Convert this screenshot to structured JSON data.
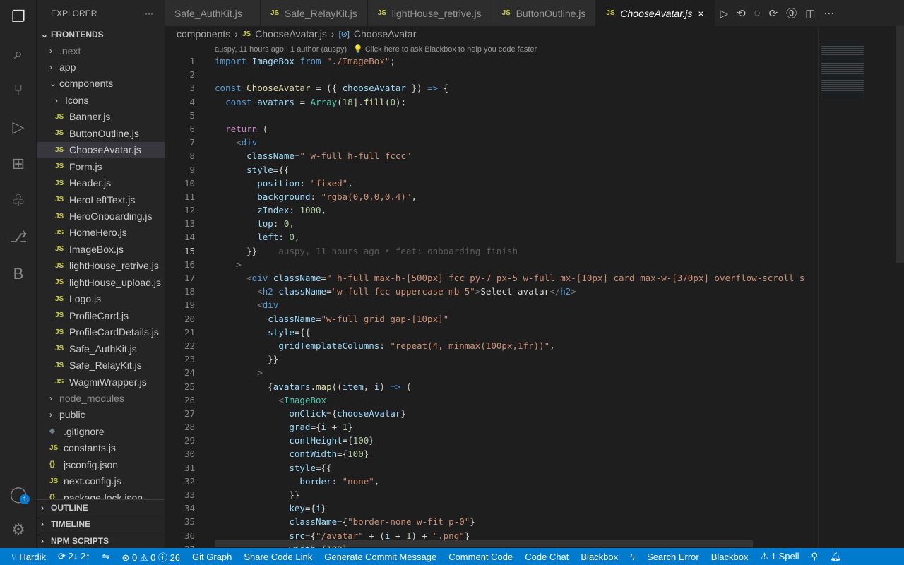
{
  "activity": [
    {
      "icon": "files-icon",
      "active": true
    },
    {
      "icon": "search-icon"
    },
    {
      "icon": "source-control-icon"
    },
    {
      "icon": "run-debug-icon"
    },
    {
      "icon": "extensions-icon"
    },
    {
      "icon": "tree-icon"
    },
    {
      "icon": "git-graph-icon"
    },
    {
      "icon": "blackbox-icon",
      "label": "B"
    }
  ],
  "account_badge": "1",
  "sidebar": {
    "title": "EXPLORER",
    "more": "···",
    "root": "FRONTENDS",
    "items": [
      {
        "label": ".next",
        "depth": 1,
        "type": "folder",
        "open": false,
        "dim": true
      },
      {
        "label": "app",
        "depth": 1,
        "type": "folder",
        "open": false
      },
      {
        "label": "components",
        "depth": 1,
        "type": "folder",
        "open": true
      },
      {
        "label": "Icons",
        "depth": 2,
        "type": "folder",
        "open": false
      },
      {
        "label": "Banner.js",
        "depth": 2,
        "type": "js"
      },
      {
        "label": "ButtonOutline.js",
        "depth": 2,
        "type": "js"
      },
      {
        "label": "ChooseAvatar.js",
        "depth": 2,
        "type": "js",
        "selected": true
      },
      {
        "label": "Form.js",
        "depth": 2,
        "type": "js"
      },
      {
        "label": "Header.js",
        "depth": 2,
        "type": "js"
      },
      {
        "label": "HeroLeftText.js",
        "depth": 2,
        "type": "js"
      },
      {
        "label": "HeroOnboarding.js",
        "depth": 2,
        "type": "js"
      },
      {
        "label": "HomeHero.js",
        "depth": 2,
        "type": "js"
      },
      {
        "label": "ImageBox.js",
        "depth": 2,
        "type": "js"
      },
      {
        "label": "lightHouse_retrive.js",
        "depth": 2,
        "type": "js"
      },
      {
        "label": "lightHouse_upload.js",
        "depth": 2,
        "type": "js"
      },
      {
        "label": "Logo.js",
        "depth": 2,
        "type": "js"
      },
      {
        "label": "ProfileCard.js",
        "depth": 2,
        "type": "js"
      },
      {
        "label": "ProfileCardDetails.js",
        "depth": 2,
        "type": "js"
      },
      {
        "label": "Safe_AuthKit.js",
        "depth": 2,
        "type": "js"
      },
      {
        "label": "Safe_RelayKit.js",
        "depth": 2,
        "type": "js"
      },
      {
        "label": "WagmiWrapper.js",
        "depth": 2,
        "type": "js"
      },
      {
        "label": "node_modules",
        "depth": 1,
        "type": "folder",
        "open": false,
        "dim": true
      },
      {
        "label": "public",
        "depth": 1,
        "type": "folder",
        "open": false
      },
      {
        "label": ".gitignore",
        "depth": 1,
        "type": "git"
      },
      {
        "label": "constants.js",
        "depth": 1,
        "type": "js"
      },
      {
        "label": "jsconfig.json",
        "depth": 1,
        "type": "json"
      },
      {
        "label": "next.config.js",
        "depth": 1,
        "type": "js"
      },
      {
        "label": "package-lock.json",
        "depth": 1,
        "type": "json"
      }
    ],
    "panels": [
      "OUTLINE",
      "TIMELINE",
      "NPM SCRIPTS"
    ]
  },
  "tabs": [
    {
      "label": "Safe_AuthKit.js"
    },
    {
      "label": "Safe_RelayKit.js"
    },
    {
      "label": "lightHouse_retrive.js"
    },
    {
      "label": "ButtonOutline.js"
    },
    {
      "label": "ChooseAvatar.js",
      "active": true
    }
  ],
  "tab_close": "×",
  "breadcrumb": [
    "components",
    "ChooseAvatar.js",
    "ChooseAvatar"
  ],
  "codelens": "auspy, 11 hours ago | 1 author (auspy) | 💡 Click here to ask Blackbox to help you code faster",
  "current_line": 15,
  "code": [
    [
      [
        "k",
        "import"
      ],
      [
        "w",
        " "
      ],
      [
        "v",
        "ImageBox"
      ],
      [
        "w",
        " "
      ],
      [
        "k",
        "from"
      ],
      [
        "w",
        " "
      ],
      [
        "s",
        "\"./ImageBox\""
      ],
      [
        "w",
        ";"
      ]
    ],
    [],
    [
      [
        "k",
        "const"
      ],
      [
        "w",
        " "
      ],
      [
        "f",
        "ChooseAvatar"
      ],
      [
        "w",
        " = ({ "
      ],
      [
        "v",
        "chooseAvatar"
      ],
      [
        "w",
        " }) "
      ],
      [
        "k",
        "=>"
      ],
      [
        "w",
        " {"
      ]
    ],
    [
      [
        "w",
        "  "
      ],
      [
        "k",
        "const"
      ],
      [
        "w",
        " "
      ],
      [
        "v",
        "avatars"
      ],
      [
        "w",
        " = "
      ],
      [
        "t",
        "Array"
      ],
      [
        "w",
        "("
      ],
      [
        "n",
        "18"
      ],
      [
        "w",
        "]."
      ],
      [
        "f",
        "fill"
      ],
      [
        "w",
        "("
      ],
      [
        "n",
        "0"
      ],
      [
        "w",
        ");"
      ]
    ],
    [],
    [
      [
        "w",
        "  "
      ],
      [
        "c",
        "return"
      ],
      [
        "w",
        " ("
      ]
    ],
    [
      [
        "w",
        "    "
      ],
      [
        "g",
        "<"
      ],
      [
        "k",
        "div"
      ]
    ],
    [
      [
        "w",
        "      "
      ],
      [
        "v",
        "className"
      ],
      [
        "w",
        "="
      ],
      [
        "s",
        "\" w-full h-full fccc\""
      ]
    ],
    [
      [
        "w",
        "      "
      ],
      [
        "v",
        "style"
      ],
      [
        "w",
        "={{"
      ]
    ],
    [
      [
        "w",
        "        "
      ],
      [
        "v",
        "position"
      ],
      [
        "w",
        ": "
      ],
      [
        "s",
        "\"fixed\""
      ],
      [
        "w",
        ","
      ]
    ],
    [
      [
        "w",
        "        "
      ],
      [
        "v",
        "background"
      ],
      [
        "w",
        ": "
      ],
      [
        "s",
        "\"rgba(0,0,0,0.4)\""
      ],
      [
        "w",
        ","
      ]
    ],
    [
      [
        "w",
        "        "
      ],
      [
        "v",
        "zIndex"
      ],
      [
        "w",
        ": "
      ],
      [
        "n",
        "1000"
      ],
      [
        "w",
        ","
      ]
    ],
    [
      [
        "w",
        "        "
      ],
      [
        "v",
        "top"
      ],
      [
        "w",
        ": "
      ],
      [
        "n",
        "0"
      ],
      [
        "w",
        ","
      ]
    ],
    [
      [
        "w",
        "        "
      ],
      [
        "v",
        "left"
      ],
      [
        "w",
        ": "
      ],
      [
        "n",
        "0"
      ],
      [
        "w",
        ","
      ]
    ],
    [
      [
        "w",
        "      }}"
      ],
      [
        "bl",
        "    auspy, 11 hours ago • feat: onboarding finish"
      ]
    ],
    [
      [
        "w",
        "    "
      ],
      [
        "g",
        ">"
      ]
    ],
    [
      [
        "w",
        "      "
      ],
      [
        "g",
        "<"
      ],
      [
        "k",
        "div"
      ],
      [
        "w",
        " "
      ],
      [
        "v",
        "className"
      ],
      [
        "w",
        "="
      ],
      [
        "s",
        "\" h-full max-h-[500px] fcc py-7 px-5 w-full mx-[10px] card max-w-[370px] overflow-scroll s"
      ]
    ],
    [
      [
        "w",
        "        "
      ],
      [
        "g",
        "<"
      ],
      [
        "k",
        "h2"
      ],
      [
        "w",
        " "
      ],
      [
        "v",
        "className"
      ],
      [
        "w",
        "="
      ],
      [
        "s",
        "\"w-full fcc uppercase mb-5\""
      ],
      [
        "g",
        ">"
      ],
      [
        "w",
        "Select avatar"
      ],
      [
        "g",
        "</"
      ],
      [
        "k",
        "h2"
      ],
      [
        "g",
        ">"
      ]
    ],
    [
      [
        "w",
        "        "
      ],
      [
        "g",
        "<"
      ],
      [
        "k",
        "div"
      ]
    ],
    [
      [
        "w",
        "          "
      ],
      [
        "v",
        "className"
      ],
      [
        "w",
        "="
      ],
      [
        "s",
        "\"w-full grid gap-[10px]\""
      ]
    ],
    [
      [
        "w",
        "          "
      ],
      [
        "v",
        "style"
      ],
      [
        "w",
        "={{"
      ]
    ],
    [
      [
        "w",
        "            "
      ],
      [
        "v",
        "gridTemplateColumns"
      ],
      [
        "w",
        ": "
      ],
      [
        "s",
        "\"repeat(4, minmax(100px,1fr))\""
      ],
      [
        "w",
        ","
      ]
    ],
    [
      [
        "w",
        "          }}"
      ]
    ],
    [
      [
        "w",
        "        "
      ],
      [
        "g",
        ">"
      ]
    ],
    [
      [
        "w",
        "          {"
      ],
      [
        "v",
        "avatars"
      ],
      [
        "w",
        "."
      ],
      [
        "f",
        "map"
      ],
      [
        "w",
        "(("
      ],
      [
        "v",
        "item"
      ],
      [
        "w",
        ", "
      ],
      [
        "v",
        "i"
      ],
      [
        "w",
        ") "
      ],
      [
        "k",
        "=>"
      ],
      [
        "w",
        " ("
      ]
    ],
    [
      [
        "w",
        "            "
      ],
      [
        "g",
        "<"
      ],
      [
        "t",
        "ImageBox"
      ]
    ],
    [
      [
        "w",
        "              "
      ],
      [
        "v",
        "onClick"
      ],
      [
        "w",
        "={"
      ],
      [
        "v",
        "chooseAvatar"
      ],
      [
        "w",
        "}"
      ]
    ],
    [
      [
        "w",
        "              "
      ],
      [
        "v",
        "grad"
      ],
      [
        "w",
        "={"
      ],
      [
        "v",
        "i"
      ],
      [
        "w",
        " + "
      ],
      [
        "n",
        "1"
      ],
      [
        "w",
        "}"
      ]
    ],
    [
      [
        "w",
        "              "
      ],
      [
        "v",
        "contHeight"
      ],
      [
        "w",
        "={"
      ],
      [
        "n",
        "100"
      ],
      [
        "w",
        "}"
      ]
    ],
    [
      [
        "w",
        "              "
      ],
      [
        "v",
        "contWidth"
      ],
      [
        "w",
        "={"
      ],
      [
        "n",
        "100"
      ],
      [
        "w",
        "}"
      ]
    ],
    [
      [
        "w",
        "              "
      ],
      [
        "v",
        "style"
      ],
      [
        "w",
        "={{"
      ]
    ],
    [
      [
        "w",
        "                "
      ],
      [
        "v",
        "border"
      ],
      [
        "w",
        ": "
      ],
      [
        "s",
        "\"none\""
      ],
      [
        "w",
        ","
      ]
    ],
    [
      [
        "w",
        "              }}"
      ]
    ],
    [
      [
        "w",
        "              "
      ],
      [
        "v",
        "key"
      ],
      [
        "w",
        "={"
      ],
      [
        "v",
        "i"
      ],
      [
        "w",
        "}"
      ]
    ],
    [
      [
        "w",
        "              "
      ],
      [
        "v",
        "className"
      ],
      [
        "w",
        "={"
      ],
      [
        "s",
        "\"border-none w-fit p-0\""
      ],
      [
        "w",
        "}"
      ]
    ],
    [
      [
        "w",
        "              "
      ],
      [
        "v",
        "src"
      ],
      [
        "w",
        "={"
      ],
      [
        "s",
        "\"/avatar\""
      ],
      [
        "w",
        " + ("
      ],
      [
        "v",
        "i"
      ],
      [
        "w",
        " + "
      ],
      [
        "n",
        "1"
      ],
      [
        "w",
        ") + "
      ],
      [
        "s",
        "\".png\""
      ],
      [
        "w",
        "}"
      ]
    ],
    [
      [
        "w",
        "              "
      ],
      [
        "v",
        "width"
      ],
      [
        "w",
        "={"
      ],
      [
        "n",
        "100"
      ],
      [
        "w",
        "}"
      ]
    ]
  ],
  "status": [
    {
      "icon": "branch-icon",
      "label": "Hardik"
    },
    {
      "icon": "sync-icon",
      "label": "2↓ 2↑"
    },
    {
      "icon": "git-compare-icon",
      "label": ""
    },
    {
      "icon": "error-icon",
      "label": "⊗ 0 ⚠ 0 ⓘ 26"
    },
    {
      "label": "Git Graph"
    },
    {
      "label": "Share Code Link"
    },
    {
      "label": "Generate Commit Message"
    },
    {
      "label": "Comment Code"
    },
    {
      "label": "Code Chat"
    },
    {
      "label": "Blackbox"
    },
    {
      "icon": "lightning-icon",
      "label": "ϟ"
    },
    {
      "label": "Search Error"
    },
    {
      "label": "Blackbox"
    },
    {
      "label": "⚠ 1 Spell"
    },
    {
      "icon": "feedback-icon",
      "label": "⚲"
    },
    {
      "icon": "bell-icon",
      "label": "🔔︎"
    }
  ]
}
